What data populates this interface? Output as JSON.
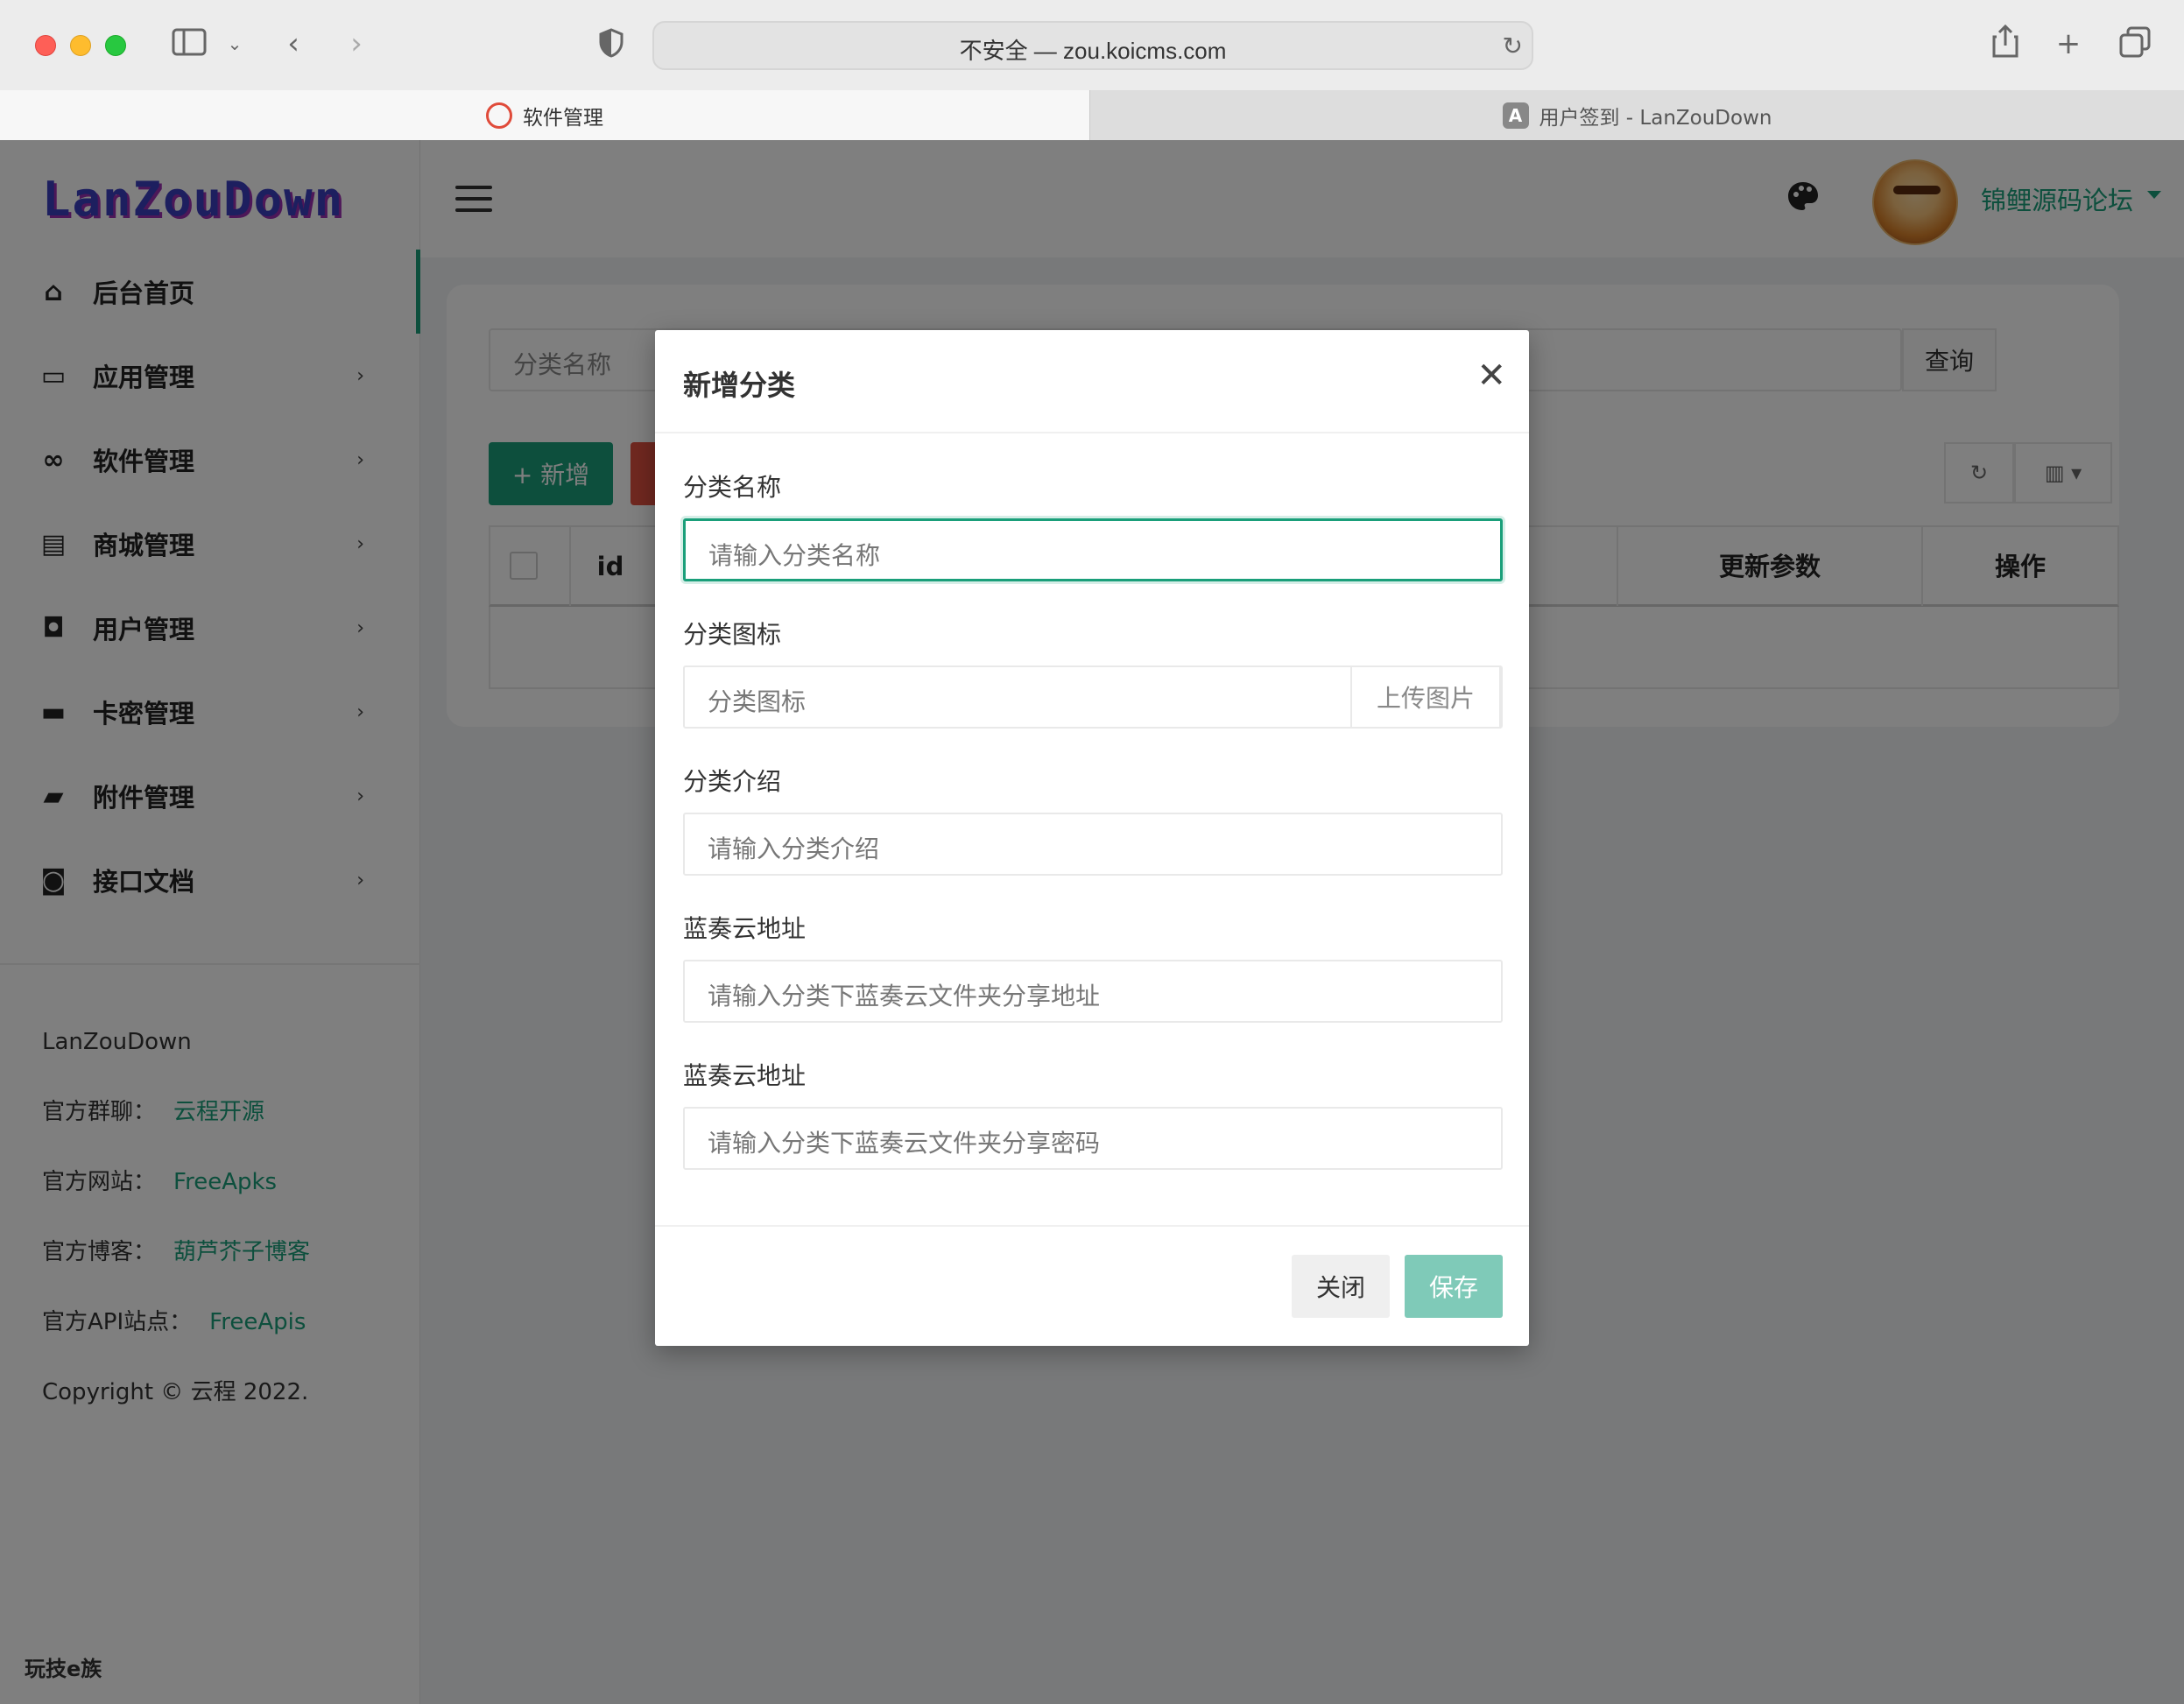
{
  "browser": {
    "address": "不安全 — zou.koicms.com",
    "tabs": [
      {
        "label": "软件管理"
      },
      {
        "label": "用户签到 - LanZouDown"
      }
    ]
  },
  "sidebar": {
    "logo": "LanZouDown",
    "items": [
      {
        "label": "后台首页",
        "icon": "home-icon"
      },
      {
        "label": "应用管理",
        "icon": "computer-icon"
      },
      {
        "label": "软件管理",
        "icon": "infinity-icon"
      },
      {
        "label": "商城管理",
        "icon": "store-icon"
      },
      {
        "label": "用户管理",
        "icon": "user-badge-icon"
      },
      {
        "label": "卡密管理",
        "icon": "card-icon"
      },
      {
        "label": "附件管理",
        "icon": "folder-icon"
      },
      {
        "label": "接口文档",
        "icon": "inbox-icon"
      }
    ],
    "info": {
      "brand": "LanZouDown",
      "group_label": "官方群聊：",
      "group_link": "云程开源",
      "site_label": "官方网站：",
      "site_link": "FreeApks",
      "blog_label": "官方博客：",
      "blog_link": "葫芦芥子博客",
      "api_label": "官方API站点：",
      "api_link": "FreeApis",
      "copyright": "Copyright © 云程 2022."
    },
    "watermark": "玩技e族"
  },
  "topbar": {
    "user_name": "锦鲤源码论坛"
  },
  "content": {
    "search_placeholder": "分类名称",
    "query_label": "查询",
    "add_label": "+ 新增",
    "table_headers": {
      "id": "id",
      "update_params": "更新参数",
      "actions": "操作"
    }
  },
  "modal": {
    "title": "新增分类",
    "fields": {
      "name": {
        "label": "分类名称",
        "placeholder": "请输入分类名称"
      },
      "icon": {
        "label": "分类图标",
        "placeholder": "分类图标",
        "upload_label": "上传图片"
      },
      "intro": {
        "label": "分类介绍",
        "placeholder": "请输入分类介绍"
      },
      "lanzou_url": {
        "label": "蓝奏云地址",
        "placeholder": "请输入分类下蓝奏云文件夹分享地址"
      },
      "lanzou_pwd": {
        "label": "蓝奏云地址",
        "placeholder": "请输入分类下蓝奏云文件夹分享密码"
      }
    },
    "close_label": "关闭",
    "save_label": "保存"
  },
  "colors": {
    "accent": "#1a9f7a",
    "save_button": "#7fcab8",
    "danger": "#e05040"
  }
}
